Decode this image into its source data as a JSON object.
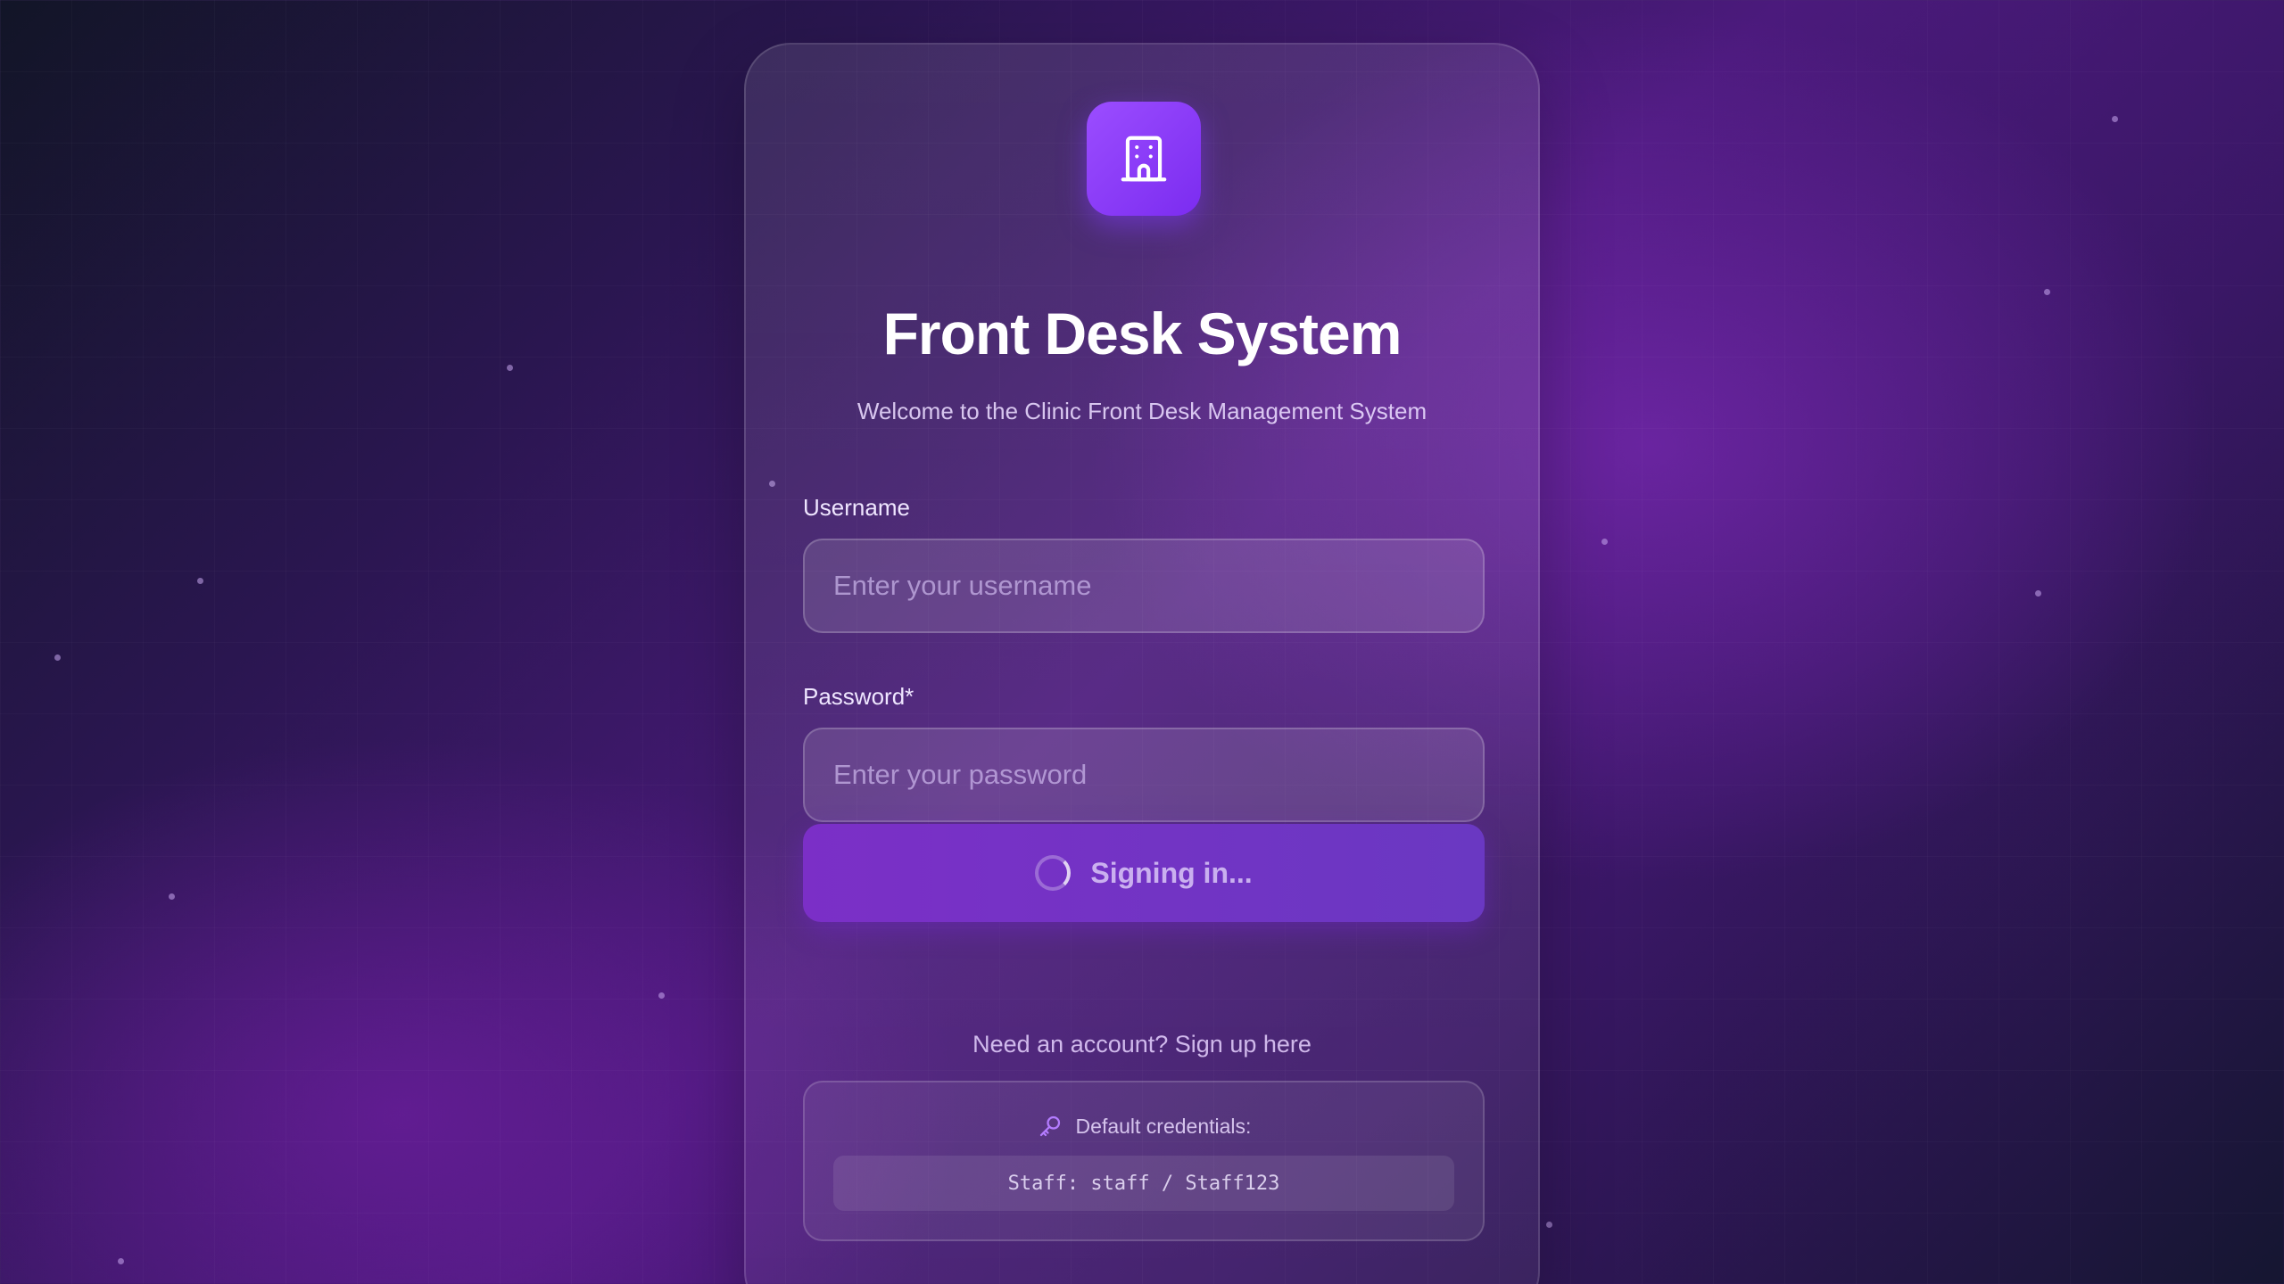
{
  "app": {
    "title": "Front Desk System",
    "subtitle": "Welcome to the Clinic Front Desk Management System",
    "logo_icon": "building-icon"
  },
  "form": {
    "username_label": "Username",
    "username_placeholder": "Enter your username",
    "username_value": "",
    "password_label": "Password*",
    "password_placeholder": "Enter your password",
    "password_value": "",
    "submit_label": "Signing in...",
    "submit_state": "loading"
  },
  "signup_link": "Need an account? Sign up here",
  "credentials": {
    "heading": "Default credentials:",
    "icon": "key-icon",
    "line": "Staff: staff / Staff123"
  },
  "colors": {
    "accent": "#8b3df5",
    "button": "#7b2fc7",
    "background": "#4b1a7c"
  }
}
